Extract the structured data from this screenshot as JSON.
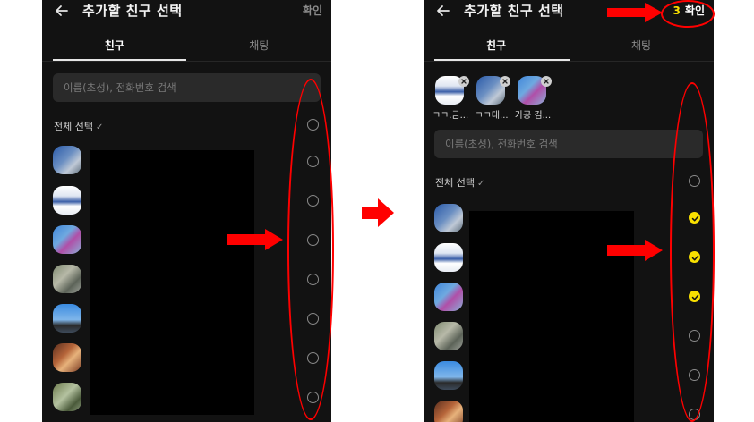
{
  "left": {
    "header": {
      "title": "추가할 친구 선택",
      "confirm": "확인"
    },
    "tabs": [
      {
        "label": "친구"
      },
      {
        "label": "채팅"
      }
    ],
    "search": {
      "placeholder": "이름(초성), 전화번호 검색"
    },
    "select_all": {
      "label": "전체 선택",
      "check": "✓"
    },
    "friends": [
      {
        "checked": false
      },
      {
        "checked": false
      },
      {
        "checked": false
      },
      {
        "checked": false
      },
      {
        "checked": false
      },
      {
        "checked": false
      },
      {
        "checked": false
      },
      {
        "checked": false
      }
    ]
  },
  "right": {
    "header": {
      "title": "추가할 친구 선택",
      "count": "3",
      "confirm": "확인"
    },
    "tabs": [
      {
        "label": "친구"
      },
      {
        "label": "채팅"
      }
    ],
    "selected": [
      {
        "label": "ㄱㄱ.금..."
      },
      {
        "label": "ㄱㄱ대..."
      },
      {
        "label": "가공 김..."
      }
    ],
    "search": {
      "placeholder": "이름(초성), 전화번호 검색"
    },
    "select_all": {
      "label": "전체 선택",
      "check": "✓"
    },
    "friends": [
      {
        "checked": false
      },
      {
        "checked": true
      },
      {
        "checked": true
      },
      {
        "checked": true
      },
      {
        "checked": false
      },
      {
        "checked": false
      },
      {
        "checked": false
      }
    ]
  },
  "colors": {
    "background": "#121212",
    "accent_yellow": "#f9e000",
    "annotation_red": "#ff0000",
    "search_bg": "#2a2a2a"
  },
  "icons": {
    "back": "arrow-left-icon",
    "remove": "close-icon",
    "check": "check-icon",
    "annotation": "red-arrow-icon"
  }
}
